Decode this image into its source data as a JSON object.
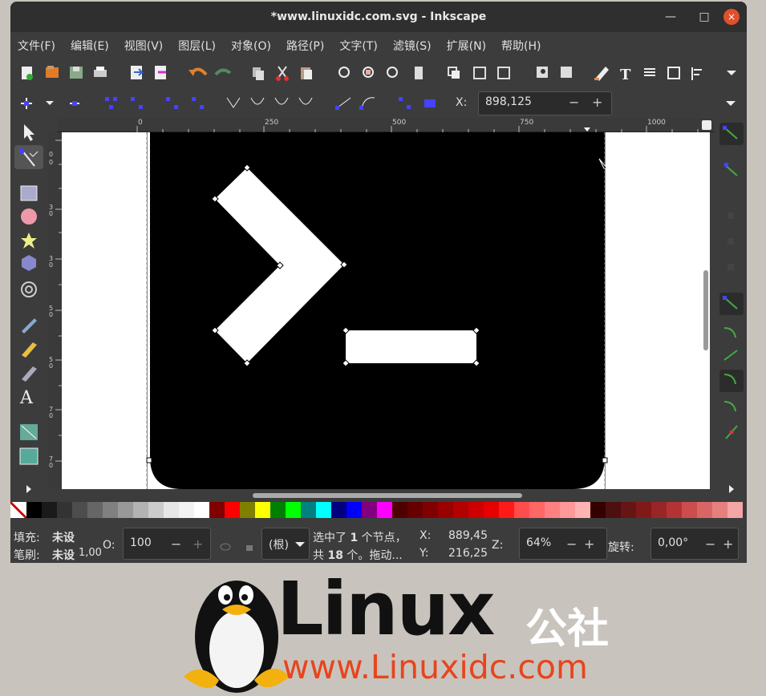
{
  "window": {
    "title": "*www.linuxidc.com.svg - Inkscape",
    "controls": {
      "minimize": "—",
      "maximize": "□",
      "close": "×"
    }
  },
  "menu": [
    "文件(F)",
    "编辑(E)",
    "视图(V)",
    "图层(L)",
    "对象(O)",
    "路径(P)",
    "文字(T)",
    "滤镜(S)",
    "扩展(N)",
    "帮助(H)"
  ],
  "node_toolbar": {
    "x_label": "X:",
    "x_value": "898,125",
    "minus": "−",
    "plus": "+"
  },
  "ruler": {
    "h_ticks": [
      "0",
      "250",
      "500",
      "750",
      "1000"
    ],
    "v_ticks": [
      "0",
      "0",
      "0",
      "250",
      "300",
      "350",
      "500",
      "550",
      "750"
    ]
  },
  "status": {
    "fill_label": "填充:",
    "fill_value": "未设",
    "stroke_label": "笔刷:",
    "stroke_value": "未设",
    "stroke_width": "1,00",
    "opacity_label": "O:",
    "opacity_value": "100",
    "layer_value": "(根)",
    "message_line1_pre": "选中了",
    "message_line1_num": "1",
    "message_line1_post": "个节点，",
    "message_line2_pre": "共",
    "message_line2_num": "18",
    "message_line2_post": "个。拖动...",
    "cursor_x_label": "X:",
    "cursor_x": "889,45",
    "cursor_y_label": "Y:",
    "cursor_y": "216,25",
    "zoom_label": "Z:",
    "zoom_value": "64%",
    "rotate_label": "旋转:",
    "rotate_value": "0,00°"
  },
  "watermark": {
    "brand": "Linux",
    "brand_cn": "公社",
    "url": "www.Linuxidc.com"
  },
  "colors": {
    "accent": "#e0502c",
    "node_select": "#1e1eff",
    "watermark_url": "#e8441c"
  },
  "palette": [
    "#000000",
    "#1a1a1a",
    "#333333",
    "#4d4d4d",
    "#666666",
    "#808080",
    "#999999",
    "#b3b3b3",
    "#cccccc",
    "#e6e6e6",
    "#f2f2f2",
    "#ffffff",
    "#800000",
    "#ff0000",
    "#808000",
    "#ffff00",
    "#008000",
    "#00ff00",
    "#008080",
    "#00ffff",
    "#000080",
    "#0000ff",
    "#800080",
    "#ff00ff",
    "#4d0000",
    "#660000",
    "#800000",
    "#990000",
    "#b30000",
    "#cc0000",
    "#e60000",
    "#ff1a1a",
    "#ff4d4d",
    "#ff6666",
    "#ff8080",
    "#ff9999",
    "#ffb3b3",
    "#330000",
    "#4d0f0f",
    "#661414",
    "#801a1a",
    "#992626",
    "#b33333",
    "#cc4d4d",
    "#d96666",
    "#e68080",
    "#f2a6a6"
  ]
}
